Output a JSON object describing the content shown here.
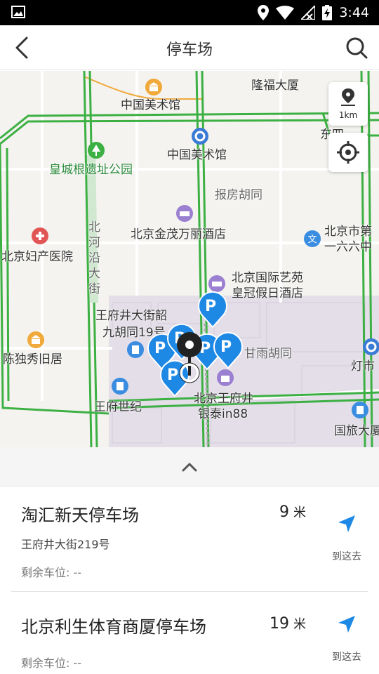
{
  "status_bar": {
    "time": "3:44"
  },
  "header": {
    "title": "停车场"
  },
  "map": {
    "scale_label": "1km",
    "labels": {
      "longfu": "隆福大厦",
      "art_museum_1": "中国美术馆",
      "art_museum_2": "中国美术馆",
      "huangcheng_park": "皇城根遗址公园",
      "baofang": "报房胡同",
      "jinmao": "北京金茂万丽酒店",
      "maternity": "北京妇产医院",
      "beiheyan_1": "北",
      "beiheyan_2": "河",
      "beiheyan_3": "沿",
      "beiheyan_4": "大",
      "beiheyan_5": "街",
      "school_1": "北京市第",
      "school_2": "一六六中",
      "crowne_1": "北京国际艺苑",
      "crowne_2": "皇冠假日酒店",
      "wfj19_1": "王府井大街韶",
      "wfj19_2": "九胡同19号",
      "ganyu": "甘雨胡同",
      "chenduxiu": "陈独秀旧居",
      "wfj_shiji": "王府世纪",
      "intime_1": "北京王府井",
      "intime_2": "银泰in88",
      "dongsi": "东四",
      "dengshi": "灯市",
      "guolv": "国旅大厦"
    }
  },
  "parking_list": [
    {
      "name": "淘汇新天停车场",
      "distance": "9",
      "unit": "米",
      "address": "王府井大街219号",
      "available": "剩余车位: --",
      "nav_label": "到这去"
    },
    {
      "name": "北京利生体育商厦停车场",
      "distance": "19",
      "unit": "米",
      "available": "剩余车位: --",
      "nav_label": "到这去"
    }
  ],
  "colors": {
    "accent": "#1e88e5",
    "road_green": "#3cb043",
    "district": "#e4dfe8"
  }
}
